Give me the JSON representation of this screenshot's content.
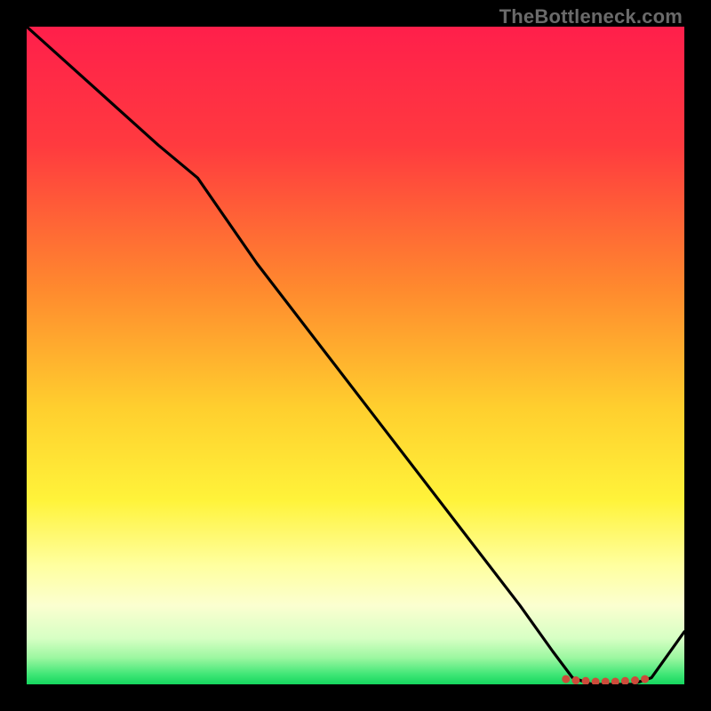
{
  "watermark": "TheBottleneck.com",
  "chart_data": {
    "type": "line",
    "title": "",
    "xlabel": "",
    "ylabel": "",
    "xlim": [
      0,
      100
    ],
    "ylim": [
      0,
      100
    ],
    "gradient_stops": [
      {
        "offset": 0,
        "color": "#ff1f4b"
      },
      {
        "offset": 18,
        "color": "#ff3a3f"
      },
      {
        "offset": 40,
        "color": "#ff8a2e"
      },
      {
        "offset": 58,
        "color": "#ffcf2e"
      },
      {
        "offset": 72,
        "color": "#fff33a"
      },
      {
        "offset": 82,
        "color": "#ffffa0"
      },
      {
        "offset": 88,
        "color": "#fbffd0"
      },
      {
        "offset": 93,
        "color": "#d7ffc4"
      },
      {
        "offset": 96,
        "color": "#9bf7a0"
      },
      {
        "offset": 98.5,
        "color": "#3fe676"
      },
      {
        "offset": 100,
        "color": "#15d65e"
      }
    ],
    "series": [
      {
        "name": "bottleneck-curve",
        "x": [
          0,
          10,
          20,
          26,
          35,
          45,
          55,
          65,
          75,
          80,
          83,
          86,
          89,
          92,
          95,
          100
        ],
        "y": [
          100,
          91,
          82,
          77,
          64,
          51,
          38,
          25,
          12,
          5,
          1,
          0,
          0,
          0,
          1,
          8
        ]
      }
    ],
    "markers": {
      "name": "optimal-range",
      "style": "dot",
      "color": "#cc4b3a",
      "x": [
        82,
        83.5,
        85,
        86.5,
        88,
        89.5,
        91,
        92.5,
        94
      ],
      "y": [
        0.8,
        0.6,
        0.5,
        0.4,
        0.4,
        0.4,
        0.5,
        0.6,
        0.8
      ]
    }
  }
}
